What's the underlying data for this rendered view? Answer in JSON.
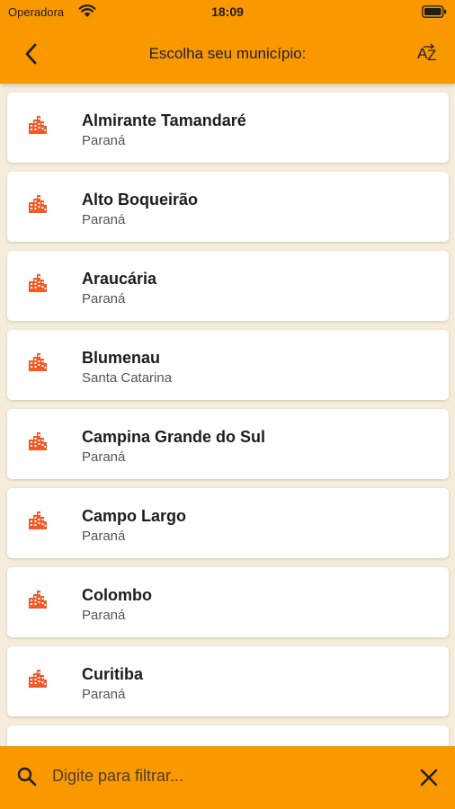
{
  "status_bar": {
    "carrier": "Operadora",
    "time": "18:09"
  },
  "header": {
    "title": "Escolha seu município:",
    "sort_icon": "sort-az-icon",
    "back_icon": "chevron-left-icon"
  },
  "colors": {
    "accent": "#fa9800",
    "background": "#f6ecdb",
    "icon": "#f05a28"
  },
  "municipios": [
    {
      "name": "Almirante Tamandaré",
      "state": "Paraná"
    },
    {
      "name": "Alto Boqueirão",
      "state": "Paraná"
    },
    {
      "name": "Araucária",
      "state": "Paraná"
    },
    {
      "name": "Blumenau",
      "state": "Santa Catarina"
    },
    {
      "name": "Campina Grande do Sul",
      "state": "Paraná"
    },
    {
      "name": "Campo Largo",
      "state": "Paraná"
    },
    {
      "name": "Colombo",
      "state": "Paraná"
    },
    {
      "name": "Curitiba",
      "state": "Paraná"
    }
  ],
  "filter": {
    "placeholder": "Digite para filtrar...",
    "value": ""
  }
}
